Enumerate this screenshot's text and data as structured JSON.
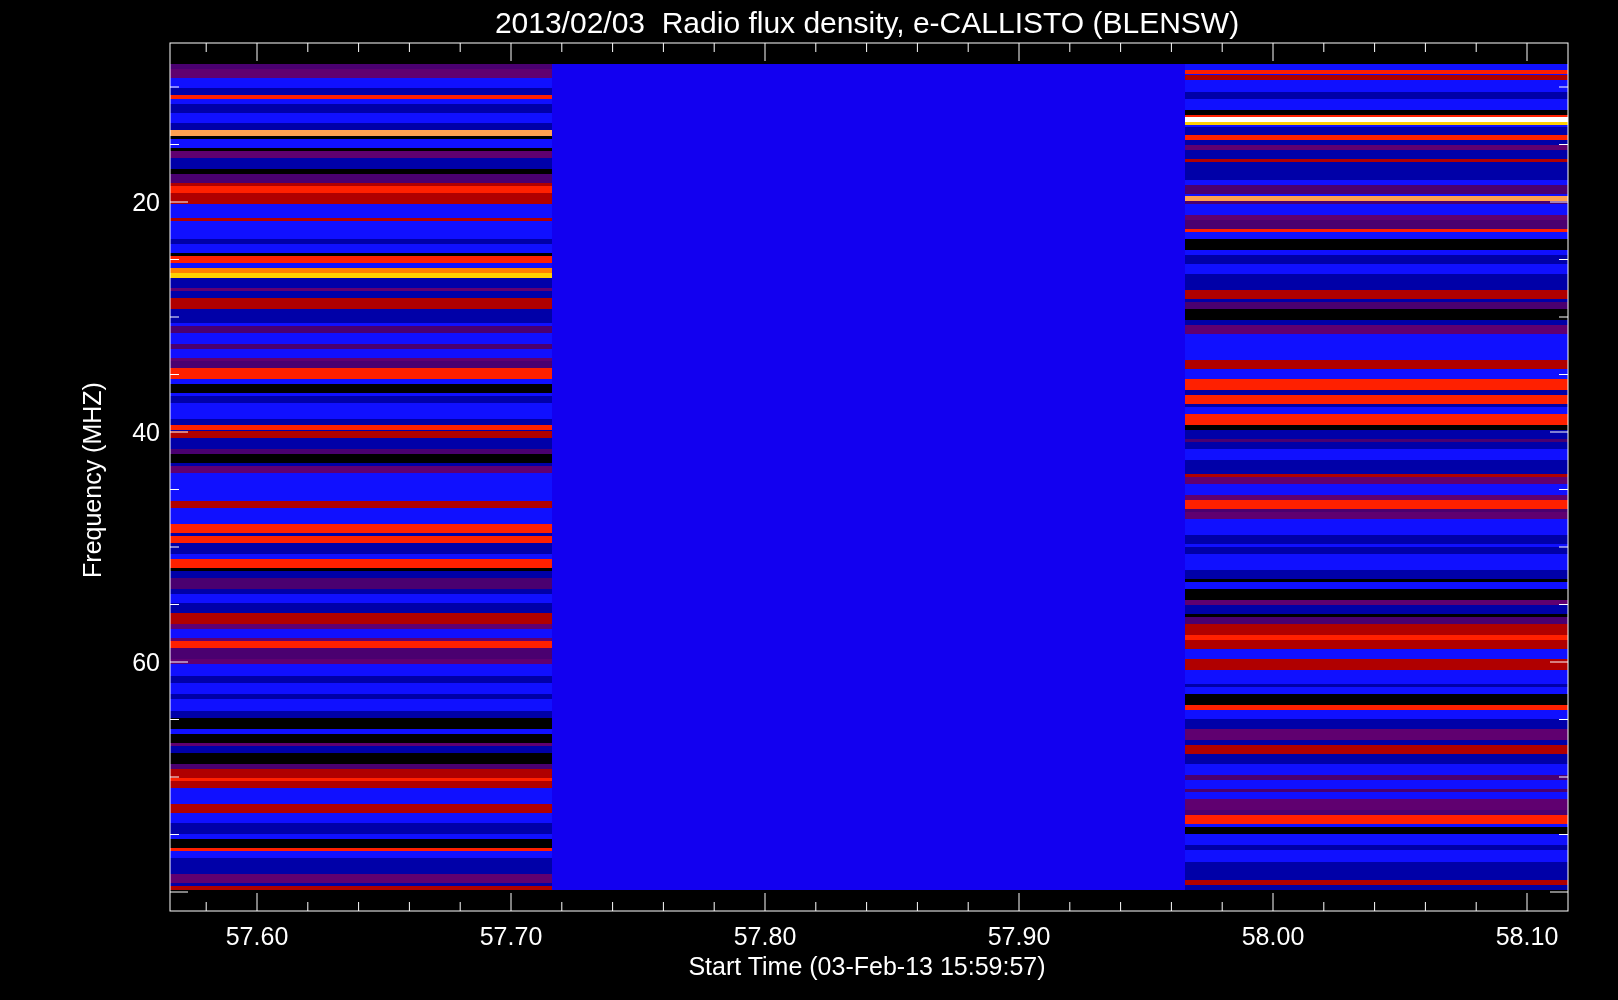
{
  "plot": {
    "title": "2013/02/03  Radio flux density, e-CALLISTO (BLENSW)",
    "xlabel": "Start Time (03-Feb-13 15:59:57)",
    "ylabel": "Frequency (MHZ)",
    "xtick_labels": [
      "57.60",
      "57.70",
      "57.80",
      "57.90",
      "58.00",
      "58.10"
    ],
    "ytick_labels": [
      "20",
      "40",
      "60"
    ]
  }
}
